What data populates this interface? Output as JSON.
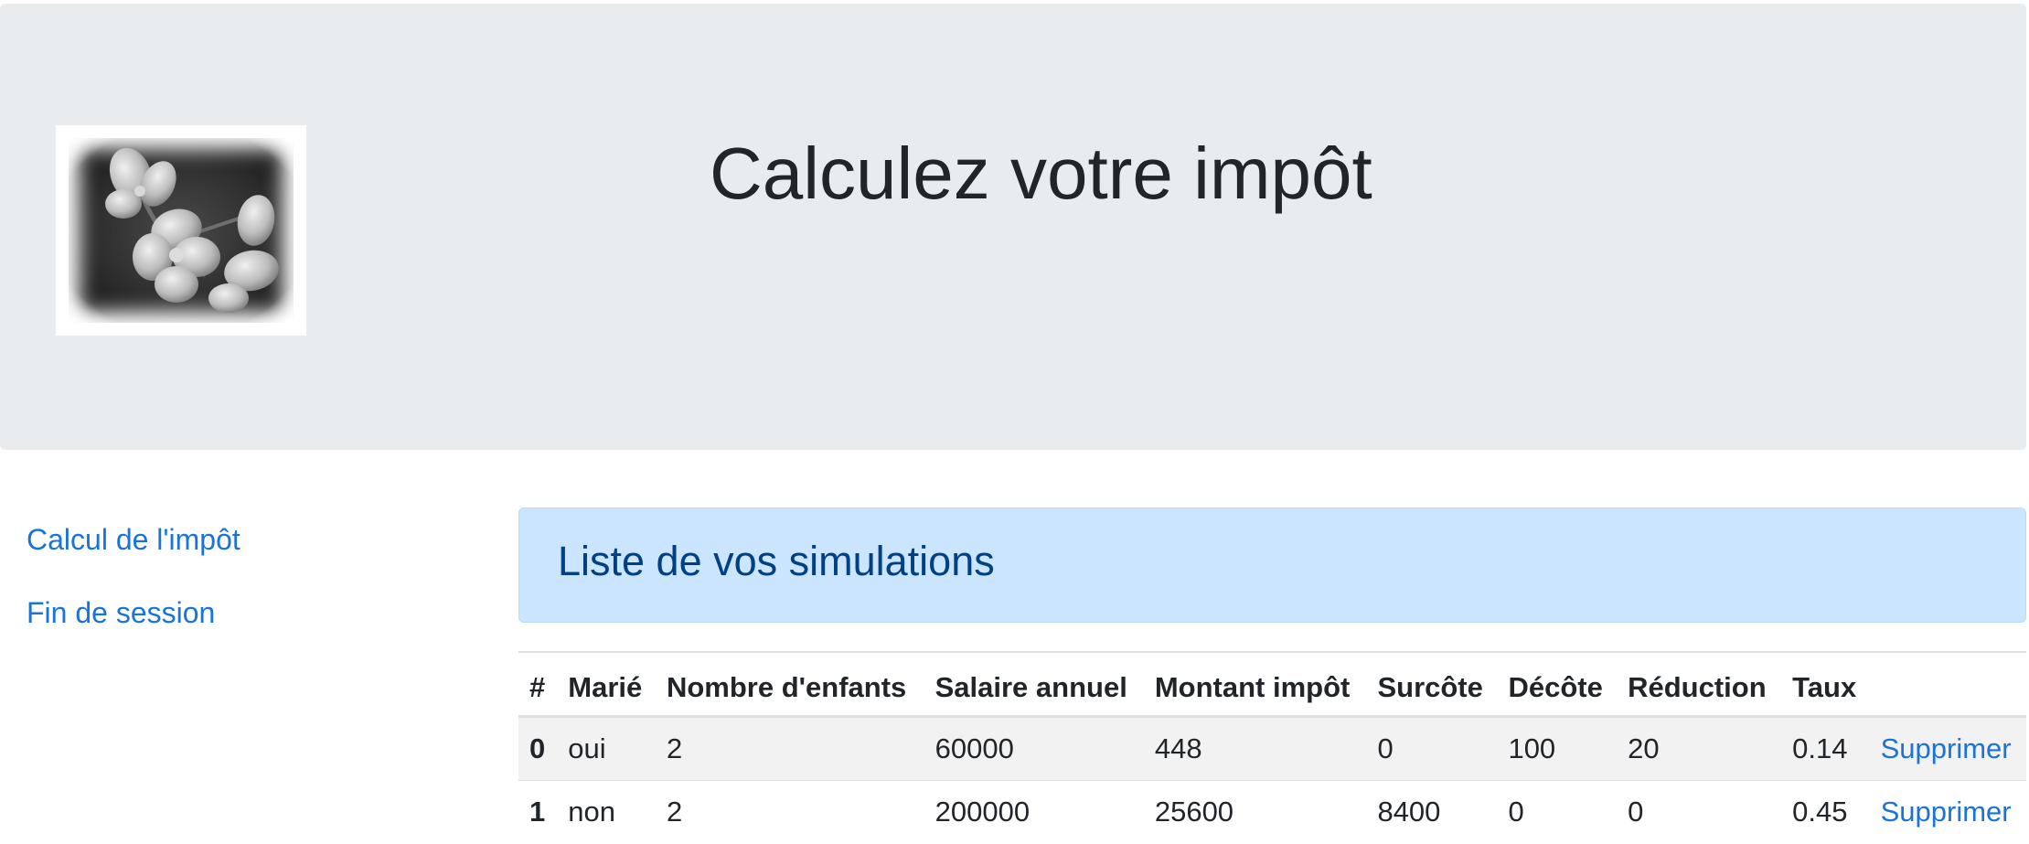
{
  "header": {
    "title": "Calculez votre impôt"
  },
  "nav": {
    "items": [
      {
        "label": "Calcul de l'impôt"
      },
      {
        "label": "Fin de session"
      }
    ]
  },
  "simulations": {
    "heading": "Liste de vos simulations",
    "columns": [
      "#",
      "Marié",
      "Nombre d'enfants",
      "Salaire annuel",
      "Montant impôt",
      "Surcôte",
      "Décôte",
      "Réduction",
      "Taux",
      ""
    ],
    "rows": [
      {
        "index": "0",
        "marie": "oui",
        "enfants": "2",
        "salaire": "60000",
        "impot": "448",
        "surcote": "0",
        "decote": "100",
        "reduction": "20",
        "taux": "0.14",
        "action": "Supprimer"
      },
      {
        "index": "1",
        "marie": "non",
        "enfants": "2",
        "salaire": "200000",
        "impot": "25600",
        "surcote": "8400",
        "decote": "0",
        "reduction": "0",
        "taux": "0.45",
        "action": "Supprimer"
      }
    ]
  },
  "colors": {
    "jumbotron_bg": "#e9ecef",
    "link": "#1a73d9",
    "alert_bg": "#cce5ff",
    "alert_text": "#004085"
  },
  "icons": {
    "logo": "flower-photo"
  }
}
